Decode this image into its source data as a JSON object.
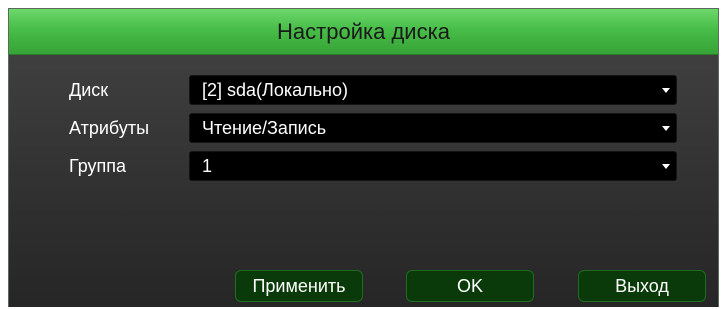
{
  "dialog": {
    "title": "Настройка диска"
  },
  "form": {
    "rows": [
      {
        "label": "Диск",
        "value": "[2] sda(Локально)"
      },
      {
        "label": "Атрибуты",
        "value": "Чтение/Запись"
      },
      {
        "label": "Группа",
        "value": "1"
      }
    ]
  },
  "buttons": {
    "apply": "Применить",
    "ok": "OK",
    "exit": "Выход"
  },
  "colors": {
    "title_bar": "#48bd48",
    "panel_bg": "#333333",
    "button_bg": "#0a3a0a",
    "button_border": "#1f6b1f"
  }
}
